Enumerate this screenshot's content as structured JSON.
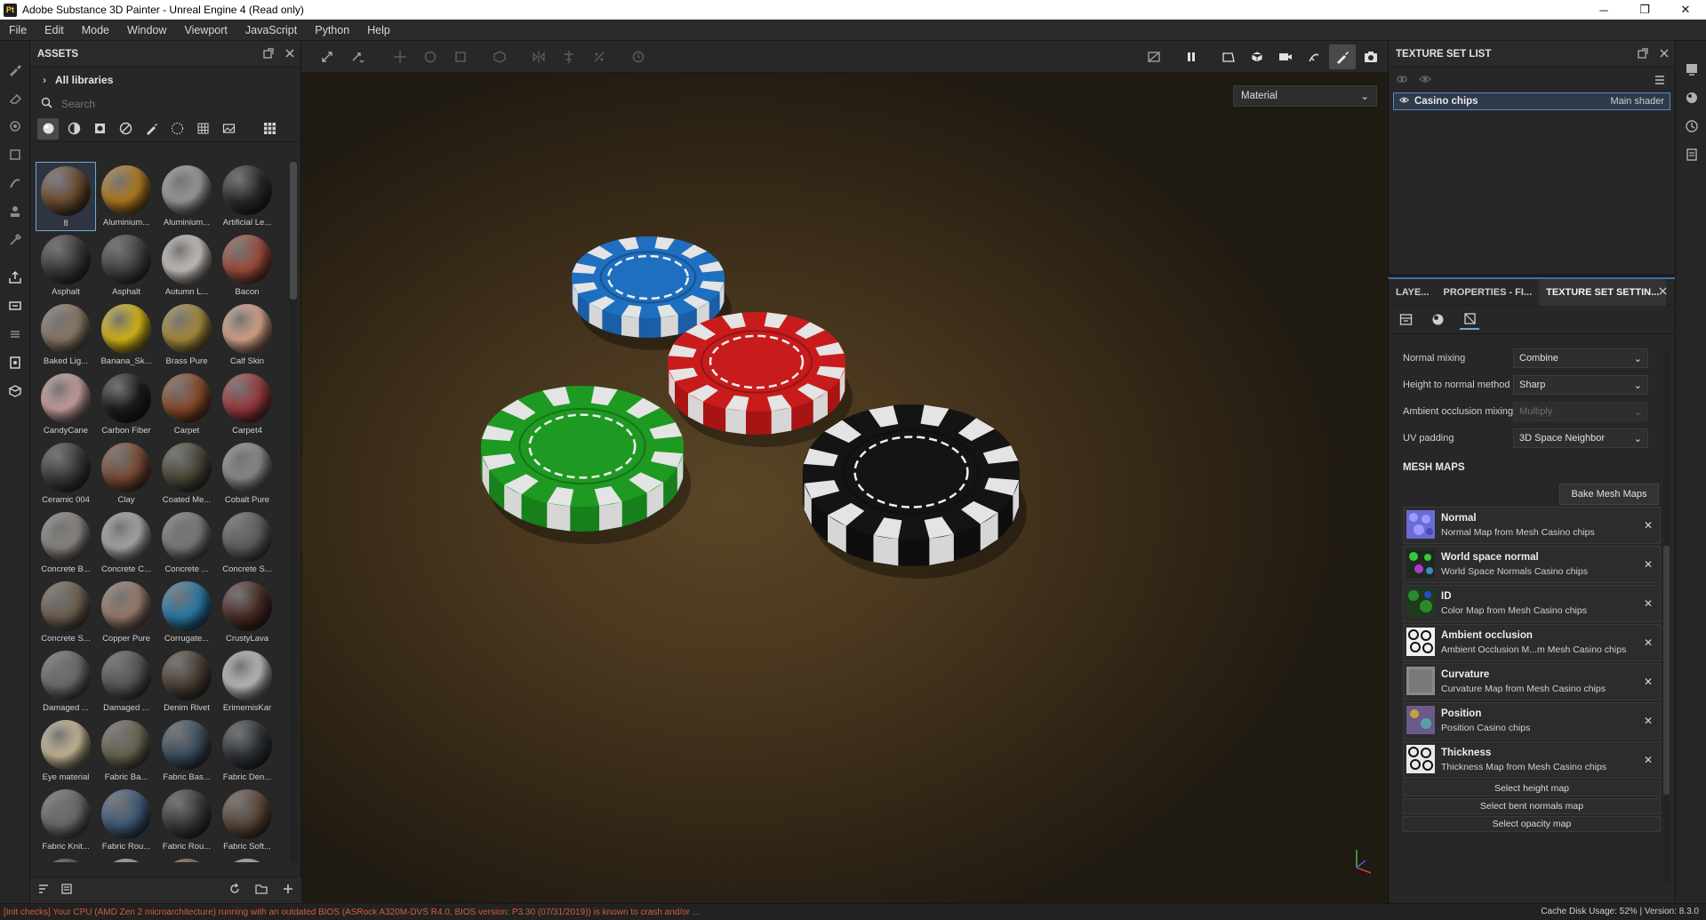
{
  "window": {
    "app_badge": "Pt",
    "title": "Adobe Substance 3D Painter - Unreal Engine 4 (Read only)",
    "minimize": "─",
    "maximize": "❐",
    "close": "✕"
  },
  "menu": [
    "File",
    "Edit",
    "Mode",
    "Window",
    "Viewport",
    "JavaScript",
    "Python",
    "Help"
  ],
  "assets": {
    "title": "ASSETS",
    "libraries_label": "All libraries",
    "search_placeholder": "Search",
    "items": [
      {
        "name": "8",
        "color": "#6b4a2e"
      },
      {
        "name": "Aluminium...",
        "color": "#b07a20"
      },
      {
        "name": "Aluminium...",
        "color": "#9a9a9a"
      },
      {
        "name": "Artificial Le...",
        "color": "#2a2a2a"
      },
      {
        "name": "Asphalt",
        "color": "#3a3a3a"
      },
      {
        "name": "Asphalt",
        "color": "#424242"
      },
      {
        "name": "Autumn L...",
        "color": "#c9c2bd"
      },
      {
        "name": "Bacon",
        "color": "#9e4b3a"
      },
      {
        "name": "Baked Lig...",
        "color": "#8a7866"
      },
      {
        "name": "Banana_Sk...",
        "color": "#d8b814"
      },
      {
        "name": "Brass Pure",
        "color": "#a88c3c"
      },
      {
        "name": "Calf Skin",
        "color": "#d9a58a"
      },
      {
        "name": "CandyCane",
        "color": "#c9a0a0"
      },
      {
        "name": "Carbon Fiber",
        "color": "#1c1c1c"
      },
      {
        "name": "Carpet",
        "color": "#8a4a2a"
      },
      {
        "name": "Carpet4",
        "color": "#9a3a3e"
      },
      {
        "name": "Ceramic 004",
        "color": "#3a3a3a"
      },
      {
        "name": "Clay",
        "color": "#7a4a34"
      },
      {
        "name": "Coated Me...",
        "color": "#4a4636"
      },
      {
        "name": "Cobalt Pure",
        "color": "#8a8a8a"
      },
      {
        "name": "Concrete B...",
        "color": "#8a8680"
      },
      {
        "name": "Concrete C...",
        "color": "#a8a8a8"
      },
      {
        "name": "Concrete ...",
        "color": "#7a7a7a"
      },
      {
        "name": "Concrete S...",
        "color": "#5e5e5e"
      },
      {
        "name": "Concrete S...",
        "color": "#6e6050"
      },
      {
        "name": "Copper Pure",
        "color": "#9a7a6a"
      },
      {
        "name": "Corrugate...",
        "color": "#2a7aa8"
      },
      {
        "name": "CrustyLava",
        "color": "#4a2a24"
      },
      {
        "name": "Damaged ...",
        "color": "#6a6a6a"
      },
      {
        "name": "Damaged ...",
        "color": "#555555"
      },
      {
        "name": "Denim Rivet",
        "color": "#4a3e32"
      },
      {
        "name": "ErimemisKar",
        "color": "#bcbcbc"
      },
      {
        "name": "Eye material",
        "color": "#c8b898"
      },
      {
        "name": "Fabric Ba...",
        "color": "#6a6450"
      },
      {
        "name": "Fabric Bas...",
        "color": "#3a4e5e"
      },
      {
        "name": "Fabric Den...",
        "color": "#2e3236"
      },
      {
        "name": "Fabric Knit...",
        "color": "#6a6a6a"
      },
      {
        "name": "Fabric Rou...",
        "color": "#3e5a7a"
      },
      {
        "name": "Fabric Rou...",
        "color": "#3a3a3a"
      },
      {
        "name": "Fabric Soft...",
        "color": "#5a4638"
      },
      {
        "name": "",
        "color": "#4a4a4a"
      },
      {
        "name": "",
        "color": "#9a9a9a"
      },
      {
        "name": "",
        "color": "#8a5a3a"
      },
      {
        "name": "",
        "color": "#aaaaaa"
      }
    ]
  },
  "viewport": {
    "material_mode": "Material"
  },
  "texture_set_list": {
    "title": "TEXTURE SET LIST",
    "item_name": "Casino chips",
    "item_shader": "Main shader"
  },
  "texture_set_settings": {
    "tabs": [
      "LAYE...",
      "PROPERTIES - FI...",
      "TEXTURE SET SETTIN..."
    ],
    "properties": [
      {
        "label": "Normal mixing",
        "value": "Combine",
        "disabled": false
      },
      {
        "label": "Height to normal method",
        "value": "Sharp",
        "disabled": false
      },
      {
        "label": "Ambient occlusion mixing",
        "value": "Multiply",
        "disabled": true
      },
      {
        "label": "UV padding",
        "value": "3D Space Neighbor",
        "disabled": false
      }
    ],
    "mesh_maps_title": "MESH MAPS",
    "bake_label": "Bake Mesh Maps",
    "mesh_maps": [
      {
        "name": "Normal",
        "desc": "Normal Map from Mesh Casino chips",
        "thumb": "normal"
      },
      {
        "name": "World space normal",
        "desc": "World Space Normals Casino chips",
        "thumb": "world"
      },
      {
        "name": "ID",
        "desc": "Color Map from Mesh Casino chips",
        "thumb": "id"
      },
      {
        "name": "Ambient occlusion",
        "desc": "Ambient Occlusion M...m Mesh Casino chips",
        "thumb": "ao"
      },
      {
        "name": "Curvature",
        "desc": "Curvature Map from Mesh Casino chips",
        "thumb": "curv"
      },
      {
        "name": "Position",
        "desc": "Position Casino chips",
        "thumb": "pos"
      },
      {
        "name": "Thickness",
        "desc": "Thickness Map from Mesh Casino chips",
        "thumb": "thick"
      }
    ],
    "select_buttons": [
      "Select height map",
      "Select bent normals map",
      "Select opacity map"
    ]
  },
  "status": {
    "warning": "[Init checks] Your CPU (AMD Zen 2 microarchitecture) running with an outdated BIOS (ASRock A320M-DVS R4.0, BIOS version: P3.30 (07/31/2019)) is known to crash and/or ...",
    "right": "Cache Disk Usage:   52% | Version: 8.3.0"
  },
  "colors": {
    "accent": "#3d6fb0",
    "warning": "#d65b3e"
  }
}
